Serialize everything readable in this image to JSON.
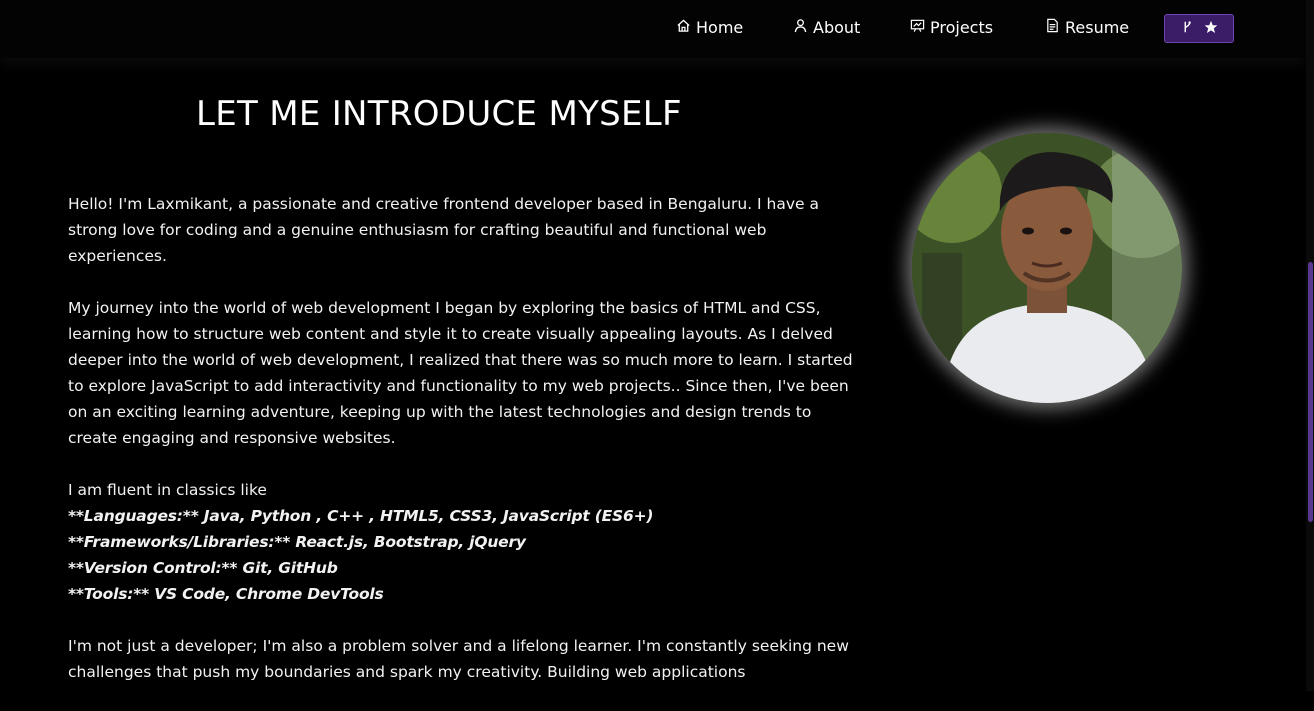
{
  "nav": {
    "items": [
      {
        "label": "Home",
        "icon": "home-icon"
      },
      {
        "label": "About",
        "icon": "user-icon"
      },
      {
        "label": "Projects",
        "icon": "projects-icon"
      },
      {
        "label": "Resume",
        "icon": "document-icon"
      }
    ],
    "github_button": {
      "icons": [
        "git-fork-icon",
        "star-icon"
      ]
    }
  },
  "main": {
    "heading": "LET ME INTRODUCE MYSELF",
    "paragraph1": "Hello! I'm Laxmikant, a passionate and creative frontend developer based in Bengaluru. I have a strong love for coding and a genuine enthusiasm for crafting beautiful and functional web experiences.",
    "paragraph2": "My journey into the world of web development I began by exploring the basics of HTML and CSS, learning how to structure web content and style it to create visually appealing layouts. As I delved deeper into the world of web development, I realized that there was so much more to learn. I started to explore JavaScript to add interactivity and functionality to my web projects.. Since then, I've been on an exciting learning adventure, keeping up with the latest technologies and design trends to create engaging and responsive websites.",
    "skills_intro": "I am fluent in classics like",
    "skills": [
      "**Languages:** Java, Python , C++ , HTML5, CSS3, JavaScript (ES6+)",
      "**Frameworks/Libraries:** React.js, Bootstrap, jQuery",
      "**Version Control:** Git, GitHub",
      "**Tools:** VS Code, Chrome DevTools"
    ],
    "paragraph4": "I'm not just a developer; I'm also a problem solver and a lifelong learner. I'm constantly seeking new challenges that push my boundaries and spark my creativity. Building web applications"
  },
  "colors": {
    "background": "#000000",
    "accent": "#3a1d66",
    "scrollbar": "#5a3890"
  }
}
